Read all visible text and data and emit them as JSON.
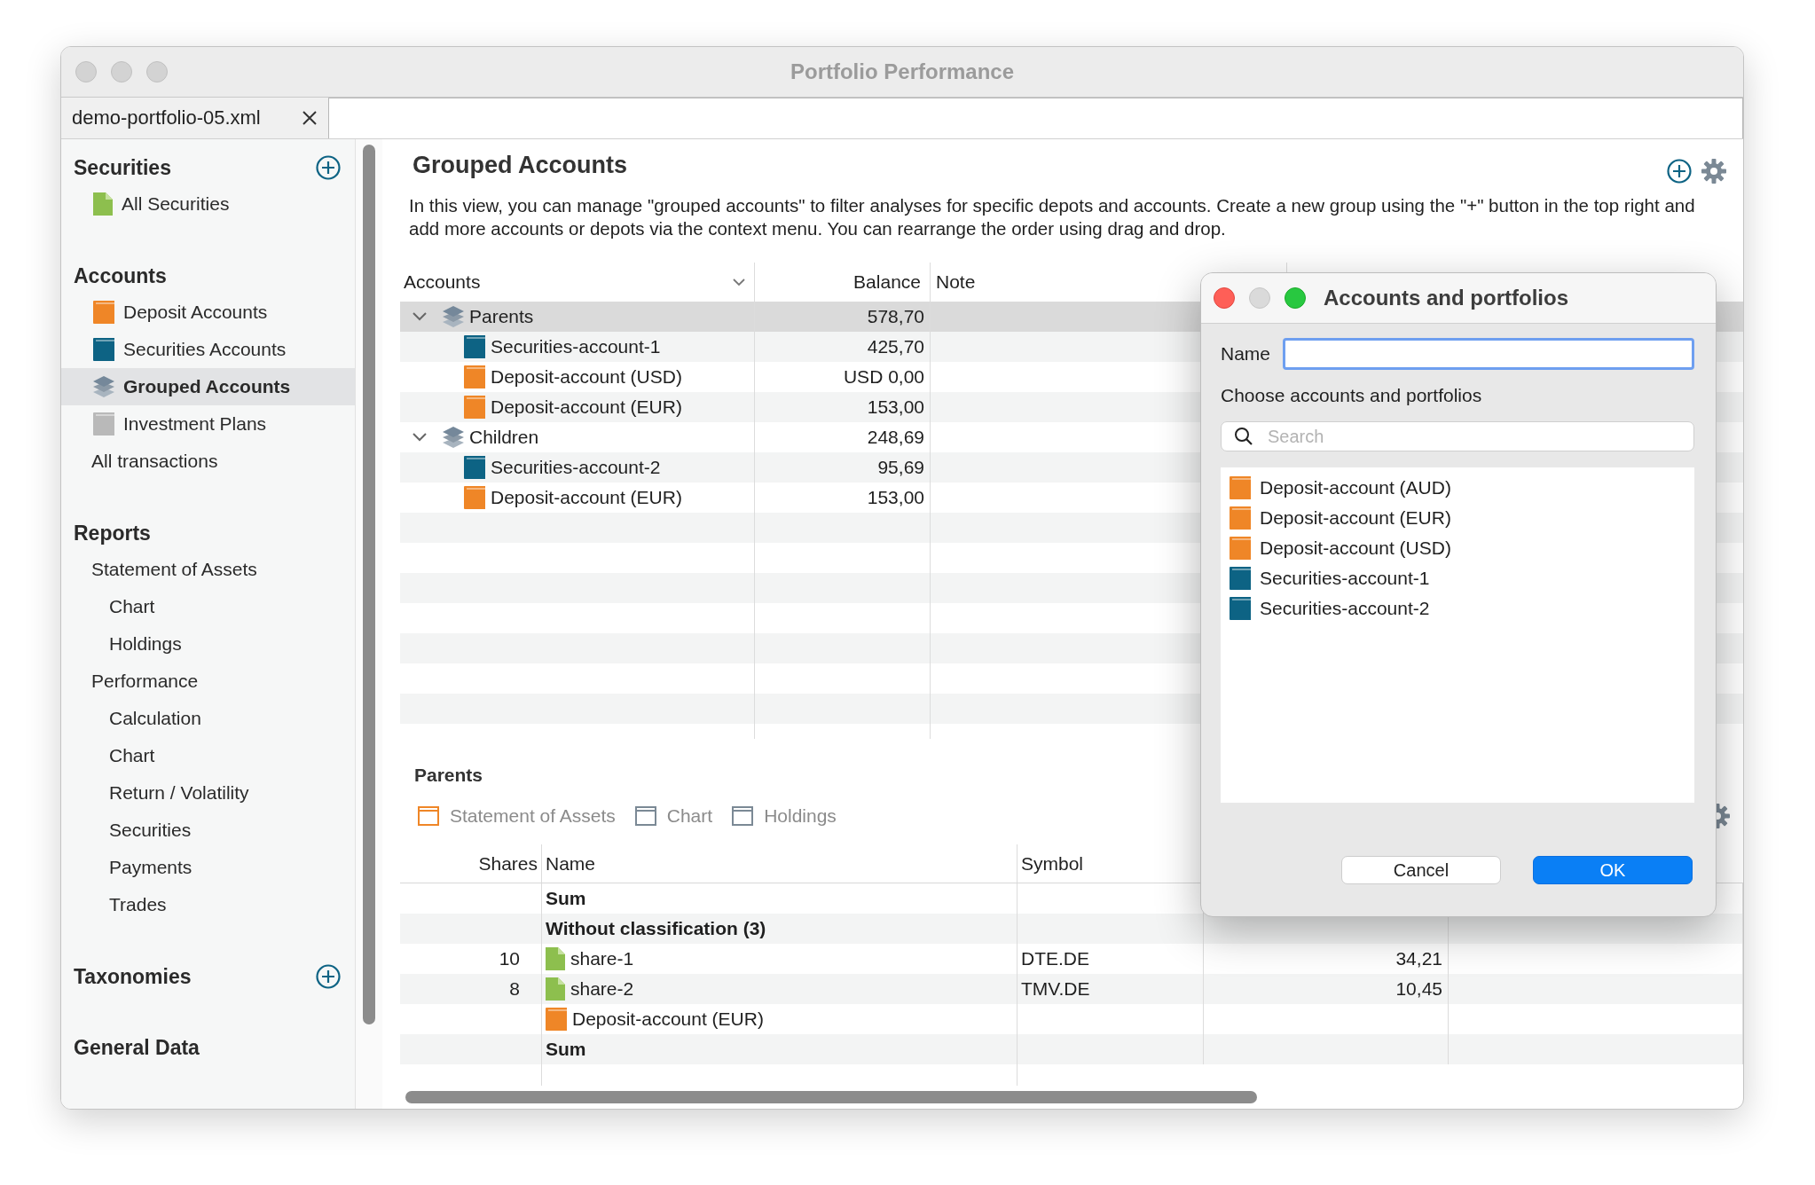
{
  "window": {
    "title": "Portfolio Performance"
  },
  "editor_tab": {
    "label": "demo-portfolio-05.xml"
  },
  "sidebar": {
    "sections": [
      {
        "title": "Securities",
        "can_add": true,
        "items": [
          {
            "label": "All Securities",
            "kind": "security",
            "selected": false
          }
        ]
      },
      {
        "title": "Accounts",
        "can_add": false,
        "items": [
          {
            "label": "Deposit Accounts",
            "kind": "deposit",
            "selected": false
          },
          {
            "label": "Securities Accounts",
            "kind": "securities",
            "selected": false
          },
          {
            "label": "Grouped Accounts",
            "kind": "group",
            "selected": true
          },
          {
            "label": "Investment Plans",
            "kind": "plan",
            "selected": false
          },
          {
            "label": "All transactions",
            "kind": "plain",
            "selected": false
          }
        ]
      },
      {
        "title": "Reports",
        "can_add": false,
        "items": [
          {
            "label": "Statement of Assets",
            "kind": "plain",
            "selected": false,
            "children": [
              {
                "label": "Chart",
                "kind": "plain",
                "selected": false
              },
              {
                "label": "Holdings",
                "kind": "plain",
                "selected": false
              }
            ]
          },
          {
            "label": "Performance",
            "kind": "plain",
            "selected": false,
            "children": [
              {
                "label": "Calculation",
                "kind": "plain",
                "selected": false
              },
              {
                "label": "Chart",
                "kind": "plain",
                "selected": false
              },
              {
                "label": "Return / Volatility",
                "kind": "plain",
                "selected": false
              },
              {
                "label": "Securities",
                "kind": "plain",
                "selected": false
              },
              {
                "label": "Payments",
                "kind": "plain",
                "selected": false
              },
              {
                "label": "Trades",
                "kind": "plain",
                "selected": false
              }
            ]
          }
        ]
      },
      {
        "title": "Taxonomies",
        "can_add": true
      },
      {
        "title": "General Data",
        "can_add": false
      }
    ]
  },
  "main": {
    "heading": "Grouped Accounts",
    "description": "In this view, you can manage \"grouped accounts\" to filter analyses for specific depots and accounts. Create a new group using the \"+\" button in the top right and add more accounts or depots via the context menu. You can rearrange the order using drag and drop."
  },
  "accounts_table": {
    "columns": [
      "Accounts",
      "Balance",
      "Note"
    ],
    "rows": [
      {
        "name": "Parents",
        "kind": "group",
        "balance": "578,70",
        "expanded": true,
        "selected": true,
        "children": [
          {
            "name": "Securities-account-1",
            "kind": "securities",
            "balance": "425,70",
            "selected": false
          },
          {
            "name": "Deposit-account (USD)",
            "kind": "deposit",
            "balance": "USD 0,00",
            "selected": false
          },
          {
            "name": "Deposit-account (EUR)",
            "kind": "deposit",
            "balance": "153,00",
            "selected": false
          }
        ]
      },
      {
        "name": "Children",
        "kind": "group",
        "balance": "248,69",
        "expanded": true,
        "selected": false,
        "children": [
          {
            "name": "Securities-account-2",
            "kind": "securities",
            "balance": "95,69",
            "selected": false
          },
          {
            "name": "Deposit-account (EUR)",
            "kind": "deposit",
            "balance": "153,00",
            "selected": false
          }
        ]
      }
    ]
  },
  "bottom": {
    "title": "Parents",
    "views": [
      {
        "label": "Statement of Assets",
        "selected": true
      },
      {
        "label": "Chart",
        "selected": false
      },
      {
        "label": "Holdings",
        "selected": false
      }
    ],
    "table": {
      "columns": [
        "Shares",
        "Name",
        "Symbol"
      ],
      "rows": [
        {
          "kind": "sum",
          "name": "Sum"
        },
        {
          "kind": "group",
          "name": "Without classification (3)"
        },
        {
          "kind": "security",
          "shares": "10",
          "name": "share-1",
          "symbol": "DTE.DE",
          "column_4": "34,21"
        },
        {
          "kind": "security",
          "shares": "8",
          "name": "share-2",
          "symbol": "TMV.DE",
          "column_4": "10,45"
        },
        {
          "kind": "account",
          "name": "Deposit-account (EUR)"
        },
        {
          "kind": "sum",
          "name": "Sum"
        }
      ]
    }
  },
  "dialog": {
    "title": "Accounts and portfolios",
    "name_label": "Name",
    "choose_label": "Choose accounts and portfolios",
    "search_placeholder": "Search",
    "items": [
      {
        "label": "Deposit-account (AUD)",
        "kind": "deposit"
      },
      {
        "label": "Deposit-account (EUR)",
        "kind": "deposit"
      },
      {
        "label": "Deposit-account (USD)",
        "kind": "deposit"
      },
      {
        "label": "Securities-account-1",
        "kind": "securities"
      },
      {
        "label": "Securities-account-2",
        "kind": "securities"
      }
    ],
    "buttons": [
      {
        "label": "Cancel",
        "kind": "default"
      },
      {
        "label": "OK",
        "kind": "primary"
      }
    ]
  }
}
